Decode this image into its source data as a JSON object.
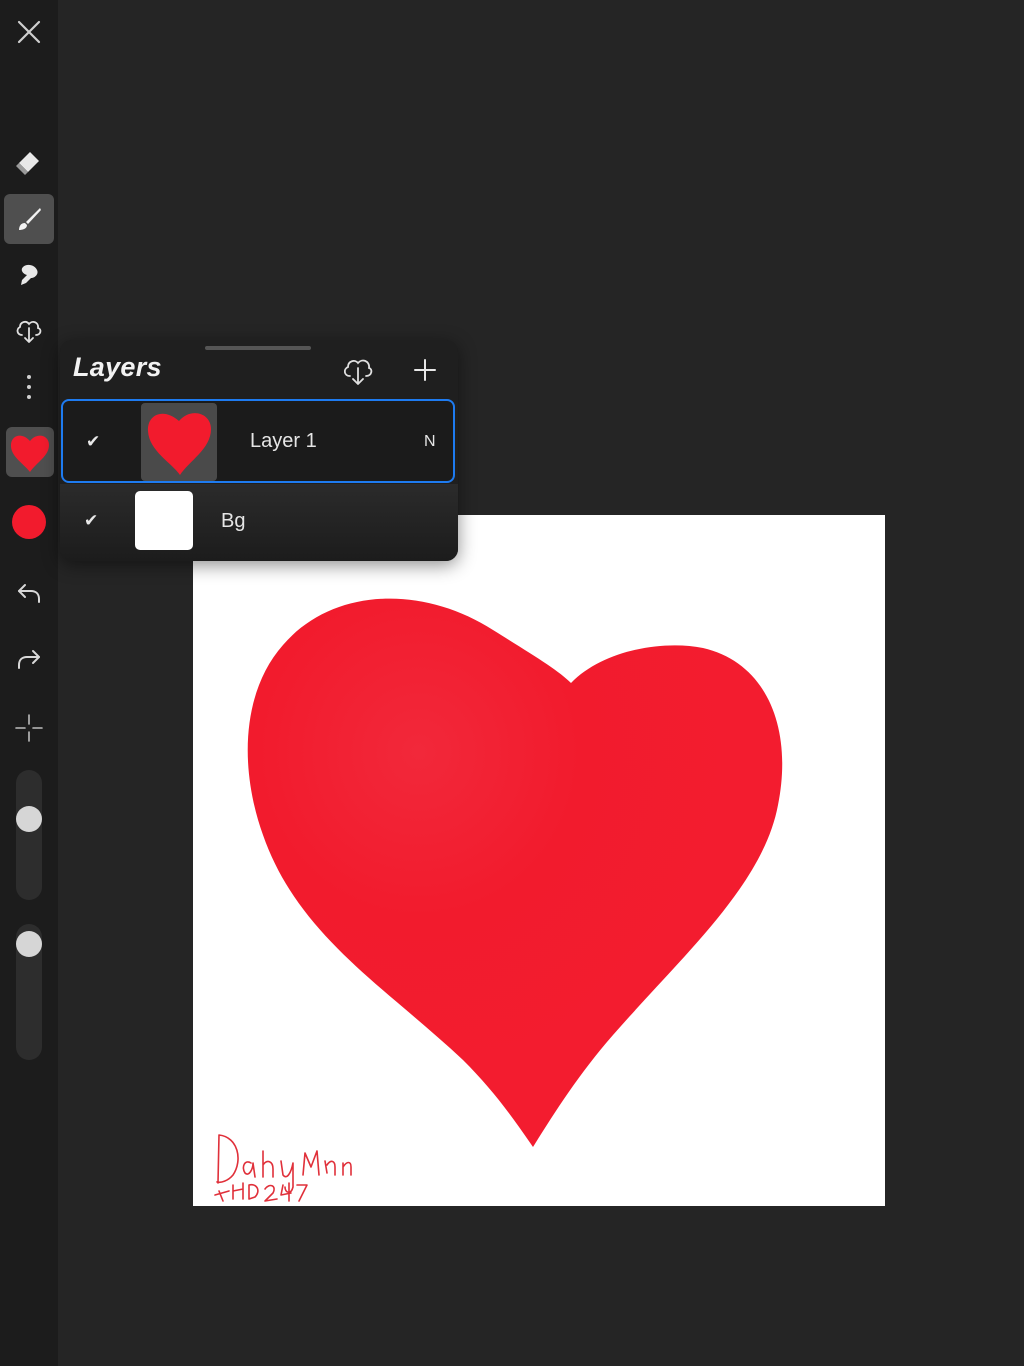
{
  "sidebar": {
    "tools": [
      {
        "name": "close-icon"
      },
      {
        "name": "eraser-icon"
      },
      {
        "name": "brush-icon",
        "active": true
      },
      {
        "name": "smudge-icon"
      },
      {
        "name": "download-cloud-icon"
      },
      {
        "name": "more-vertical-icon"
      },
      {
        "name": "layers-thumbnail"
      },
      {
        "name": "color-swatch"
      },
      {
        "name": "undo-icon"
      },
      {
        "name": "redo-icon"
      },
      {
        "name": "transform-crosshair-icon"
      }
    ],
    "brush_size_level": 0.65,
    "opacity_level": 0.06,
    "current_color": "#f21b2d"
  },
  "layers_panel": {
    "title": "Layers",
    "layers": [
      {
        "name": "Layer 1",
        "visible_check": "✔",
        "blend_mode": "N",
        "selected": true
      },
      {
        "name": "Bg",
        "visible_check": "✔",
        "selected": false
      }
    ]
  },
  "canvas": {
    "background": "#ffffff",
    "heart_color": "#f21b2d",
    "signature_color": "#e0303a"
  },
  "colors": {
    "selection_border": "#1e7bf0",
    "app_background": "#252525",
    "sidebar_background": "#1c1c1c"
  }
}
